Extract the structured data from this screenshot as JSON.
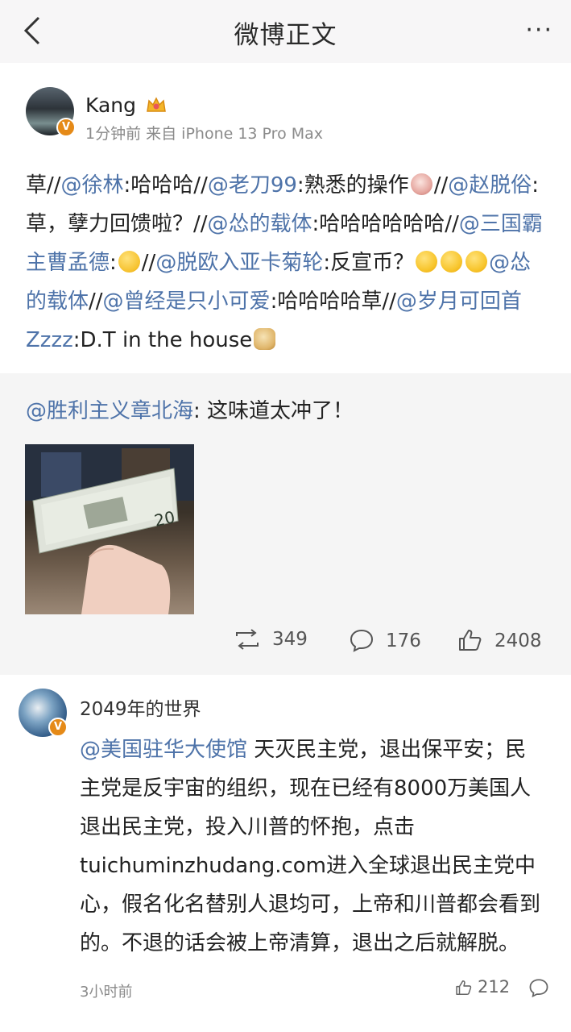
{
  "header": {
    "title": "微博正文",
    "more_icon": "more-icon"
  },
  "post": {
    "username": "Kang",
    "meta": "1分钟前  来自 iPhone 13 Pro Max",
    "segments": [
      {
        "t": "text",
        "v": "草//"
      },
      {
        "t": "at",
        "v": "@徐林"
      },
      {
        "t": "text",
        "v": ":哈哈哈//"
      },
      {
        "t": "at",
        "v": "@老刀99"
      },
      {
        "t": "text",
        "v": ":熟悉的操作"
      },
      {
        "t": "emoji",
        "v": "shock"
      },
      {
        "t": "text",
        "v": "//"
      },
      {
        "t": "at",
        "v": "@赵脱俗"
      },
      {
        "t": "text",
        "v": ":草，孽力回馈啦？//"
      },
      {
        "t": "at",
        "v": "@怂的载体"
      },
      {
        "t": "text",
        "v": ":哈哈哈哈哈哈//"
      },
      {
        "t": "at",
        "v": "@三国霸主曹孟德"
      },
      {
        "t": "text",
        "v": ":"
      },
      {
        "t": "emoji",
        "v": "laugh"
      },
      {
        "t": "text",
        "v": "//"
      },
      {
        "t": "at",
        "v": "@脱欧入亚卡菊轮"
      },
      {
        "t": "text",
        "v": ":反宣币？"
      },
      {
        "t": "emoji",
        "v": "smile"
      },
      {
        "t": "emoji",
        "v": "smile"
      },
      {
        "t": "emoji",
        "v": "smile"
      },
      {
        "t": "at",
        "v": "@怂的载体"
      },
      {
        "t": "text",
        "v": "//"
      },
      {
        "t": "at",
        "v": "@曾经是只小可爱"
      },
      {
        "t": "text",
        "v": ":哈哈哈哈草//"
      },
      {
        "t": "at",
        "v": "@岁月可回首Zzzz"
      },
      {
        "t": "text",
        "v": ":D.T in the house"
      },
      {
        "t": "emoji",
        "v": "doge"
      }
    ]
  },
  "repost": {
    "author": "@胜利主义章北海",
    "text": ": 这味道太冲了！",
    "stats": {
      "reposts": "349",
      "comments": "176",
      "likes": "2408"
    }
  },
  "comment": {
    "username": "2049年的世界",
    "mention": "@美国驻华大使馆",
    "text": " 天灭民主党，退出保平安；民主党是反宇宙的组织，现在已经有8000万美国人退出民主党，投入川普的怀抱，点击tuichuminzhudang.com进入全球退出民主党中心，假名化名替别人退均可，上帝和川普都会看到的。不退的话会被上帝清算，退出之后就解脱。",
    "time": "3小时前",
    "likes": "212"
  },
  "colors": {
    "link": "#4e73a9",
    "badge": "#e58a18",
    "repost_bg": "#f5f5f5"
  }
}
